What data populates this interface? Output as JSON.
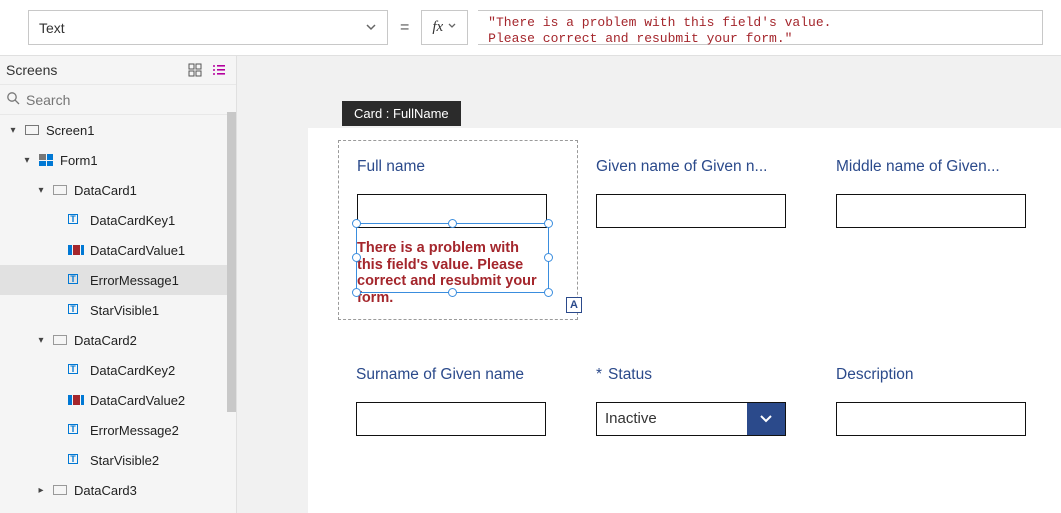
{
  "formula_bar": {
    "property": "Text",
    "value": "\"There is a problem with this field's value.\nPlease correct and resubmit your form.\""
  },
  "tree": {
    "title": "Screens",
    "search_placeholder": "Search",
    "items": {
      "screen1": "Screen1",
      "form1": "Form1",
      "datacard1": "DataCard1",
      "dckey1": "DataCardKey1",
      "dcval1": "DataCardValue1",
      "err1": "ErrorMessage1",
      "star1": "StarVisible1",
      "datacard2": "DataCard2",
      "dckey2": "DataCardKey2",
      "dcval2": "DataCardValue2",
      "err2": "ErrorMessage2",
      "star2": "StarVisible2",
      "datacard3": "DataCard3"
    }
  },
  "canvas": {
    "tooltip": "Card : FullName",
    "badge": "A",
    "fields": {
      "full_name": {
        "label": "Full name",
        "error": "There is a problem with this field's value.  Please correct and resubmit your form."
      },
      "given_name": {
        "label": "Given name of Given n..."
      },
      "middle_name": {
        "label": "Middle name of Given..."
      },
      "surname": {
        "label": "Surname of Given name"
      },
      "status": {
        "label": "Status",
        "required": "*",
        "value": "Inactive"
      },
      "description": {
        "label": "Description"
      }
    }
  }
}
